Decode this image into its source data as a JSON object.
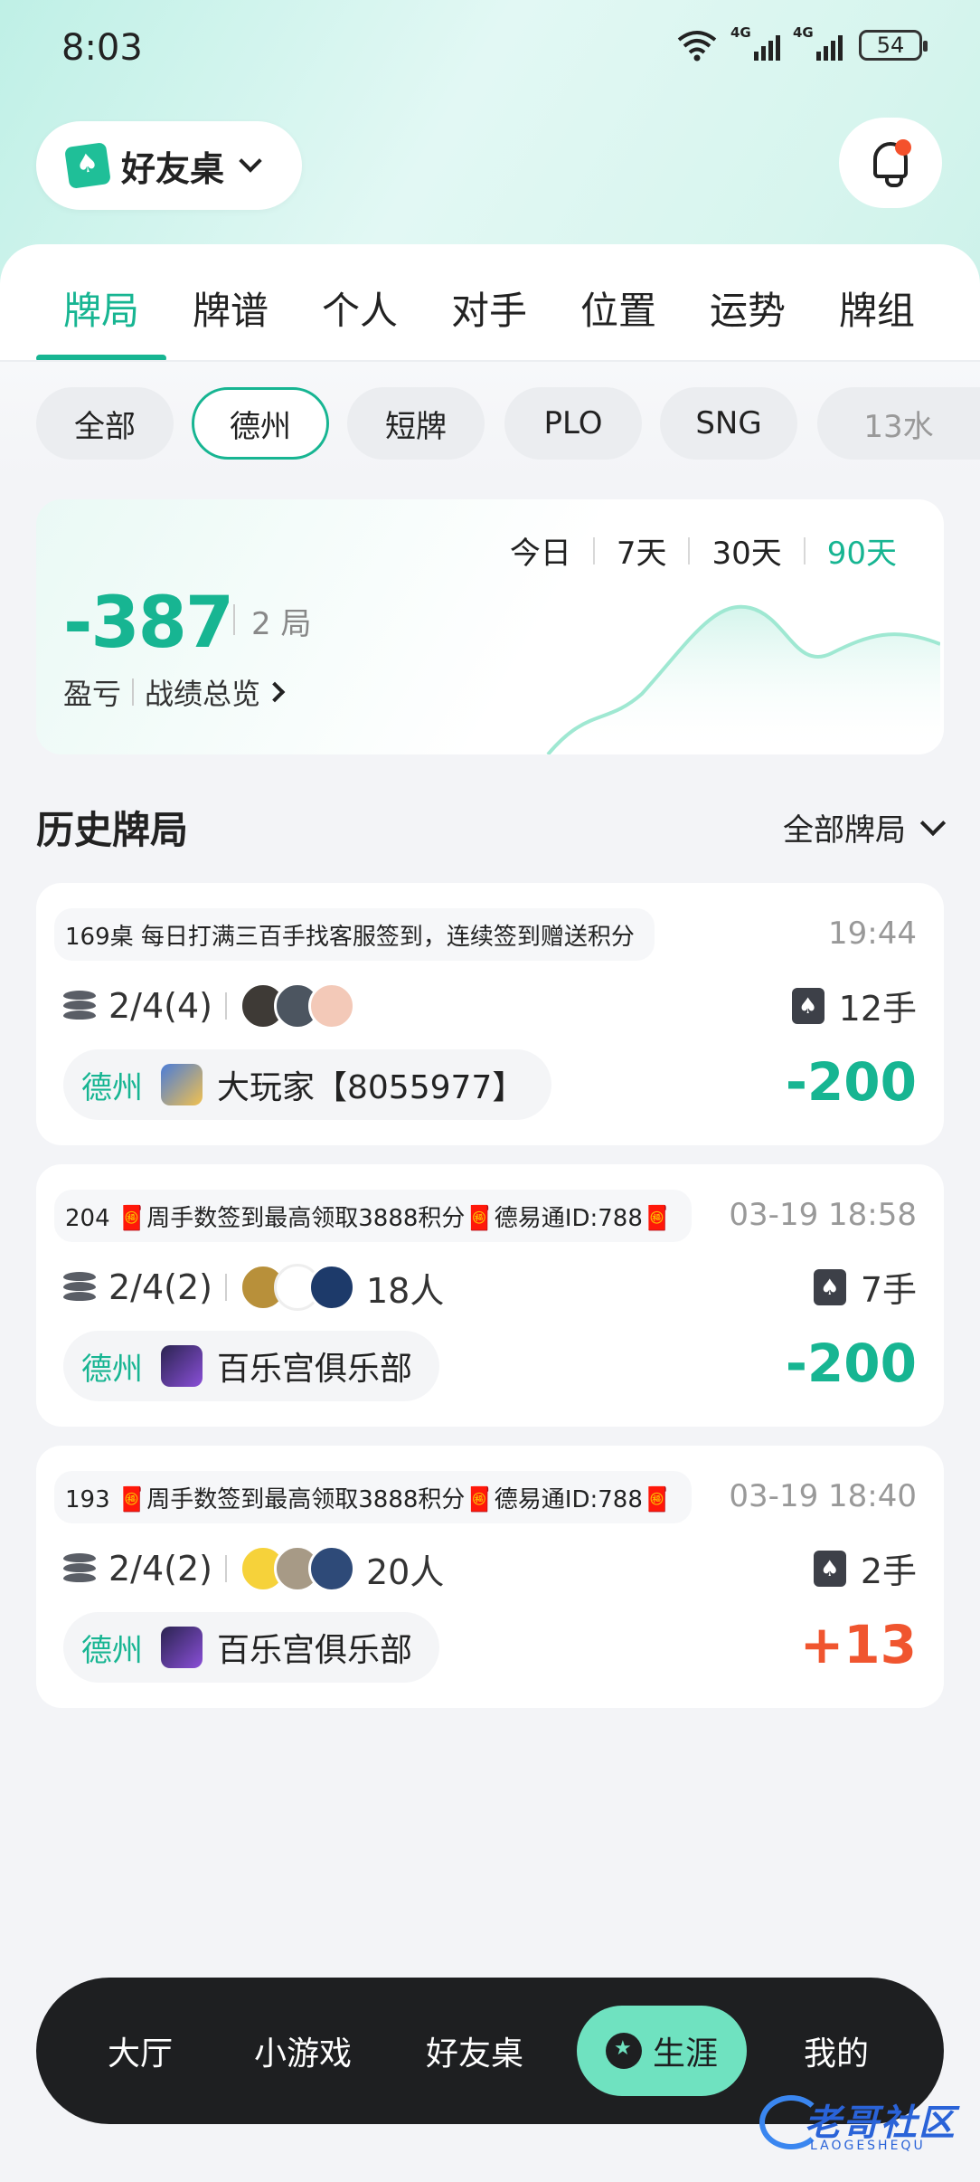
{
  "status_bar": {
    "time": "8:03",
    "network1": "4G",
    "network2": "4G",
    "battery": "54"
  },
  "header": {
    "club_title": "好友桌",
    "accent_color": "#17b592",
    "notification_dot_color": "#f4512c"
  },
  "tabs": [
    {
      "label": "牌局",
      "active": true
    },
    {
      "label": "牌谱"
    },
    {
      "label": "个人"
    },
    {
      "label": "对手"
    },
    {
      "label": "位置"
    },
    {
      "label": "运势"
    },
    {
      "label": "牌组"
    }
  ],
  "filters": [
    {
      "label": "全部"
    },
    {
      "label": "德州",
      "active": true
    },
    {
      "label": "短牌"
    },
    {
      "label": "PLO"
    },
    {
      "label": "SNG"
    },
    {
      "label": "13水"
    }
  ],
  "summary": {
    "ranges": [
      {
        "label": "今日"
      },
      {
        "label": "7天"
      },
      {
        "label": "30天"
      },
      {
        "label": "90天",
        "active": true
      }
    ],
    "pnl": "-387",
    "games": "2 局",
    "label": "盈亏",
    "link": "战绩总览"
  },
  "history": {
    "title": "历史牌局",
    "filter_label": "全部牌局",
    "games": [
      {
        "room": "169桌 每日打满三百手找客服签到，连续签到赠送积分",
        "time": "19:44",
        "blinds": "2/4(4)",
        "players": "",
        "hands": "12手",
        "game_type": "德州",
        "club": "大玩家【8055977】",
        "result": "-200",
        "result_sign": "neg"
      },
      {
        "room": "204 🧧周手数签到最高领取3888积分🧧德易通ID:788🧧",
        "time": "03-19 18:58",
        "blinds": "2/4(2)",
        "players": "18人",
        "hands": "7手",
        "game_type": "德州",
        "club": "百乐宫俱乐部",
        "result": "-200",
        "result_sign": "neg"
      },
      {
        "room": "193 🧧周手数签到最高领取3888积分🧧德易通ID:788🧧",
        "time": "03-19 18:40",
        "blinds": "2/4(2)",
        "players": "20人",
        "hands": "2手",
        "game_type": "德州",
        "club": "百乐宫俱乐部",
        "result": "+13",
        "result_sign": "pos"
      }
    ]
  },
  "bottom_nav": [
    {
      "label": "大厅"
    },
    {
      "label": "小游戏"
    },
    {
      "label": "好友桌"
    },
    {
      "label": "生涯",
      "active": true,
      "icon": "medal-icon"
    },
    {
      "label": "我的"
    }
  ],
  "watermark": {
    "text": "老哥社区",
    "sub": "LAOGESHEQU"
  }
}
